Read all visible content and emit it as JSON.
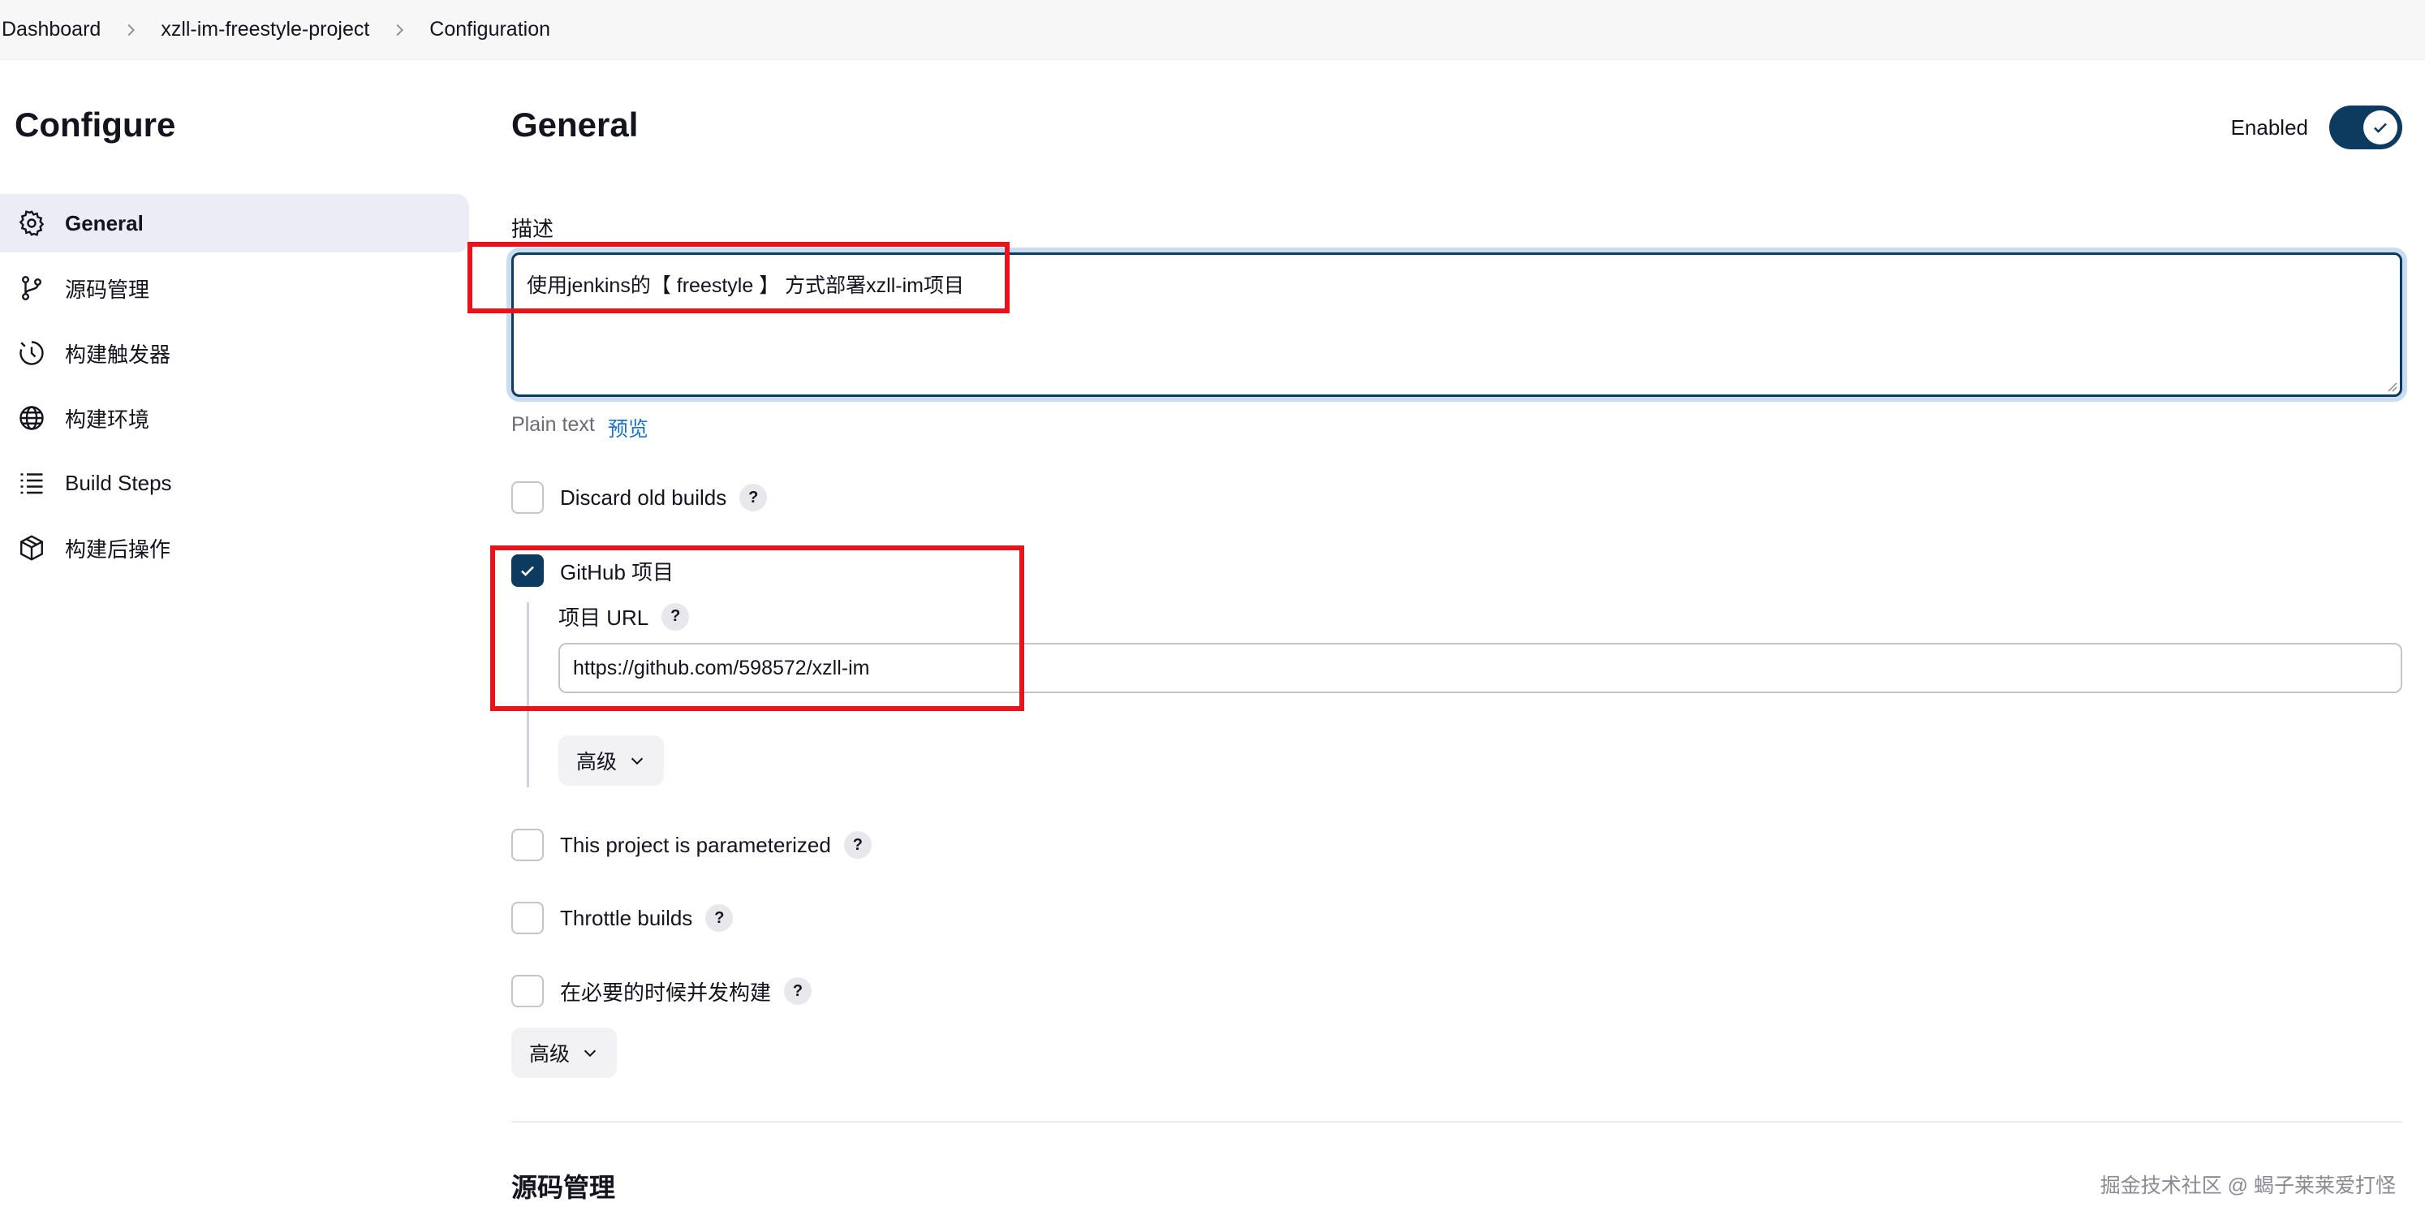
{
  "breadcrumb": {
    "items": [
      "Dashboard",
      "xzll-im-freestyle-project",
      "Configuration"
    ]
  },
  "sidebar": {
    "title": "Configure",
    "items": [
      {
        "label": "General",
        "icon": "gear-icon",
        "active": true
      },
      {
        "label": "源码管理",
        "icon": "branch-icon",
        "active": false
      },
      {
        "label": "构建触发器",
        "icon": "clock-icon",
        "active": false
      },
      {
        "label": "构建环境",
        "icon": "globe-icon",
        "active": false
      },
      {
        "label": "Build Steps",
        "icon": "list-icon",
        "active": false
      },
      {
        "label": "构建后操作",
        "icon": "package-icon",
        "active": false
      }
    ]
  },
  "general": {
    "title": "General",
    "enabled_label": "Enabled",
    "enabled": true,
    "description_label": "描述",
    "description_value": "使用jenkins的【 freestyle 】 方式部署xzll-im项目",
    "plain_text_label": "Plain text",
    "preview_link": "预览",
    "discard_old_builds": {
      "label": "Discard old builds",
      "checked": false
    },
    "github_project": {
      "label": "GitHub 项目",
      "checked": true
    },
    "project_url_label": "项目 URL",
    "project_url_value": "https://github.com/598572/xzll-im",
    "advanced_label": "高级",
    "parameterized": {
      "label": "This project is parameterized",
      "checked": false
    },
    "throttle_builds": {
      "label": "Throttle builds",
      "checked": false
    },
    "concurrent_builds": {
      "label": "在必要的时候并发构建",
      "checked": false
    },
    "advanced_label_2": "高级",
    "help_mark": "?"
  },
  "scm_section": {
    "title": "源码管理"
  },
  "watermark": "掘金技术社区 @ 蝎子莱莱爱打怪",
  "colors": {
    "accent": "#0d3b5f",
    "highlight_box": "#e8141c",
    "link": "#1a73c7",
    "active_nav_bg": "#ececf6"
  }
}
